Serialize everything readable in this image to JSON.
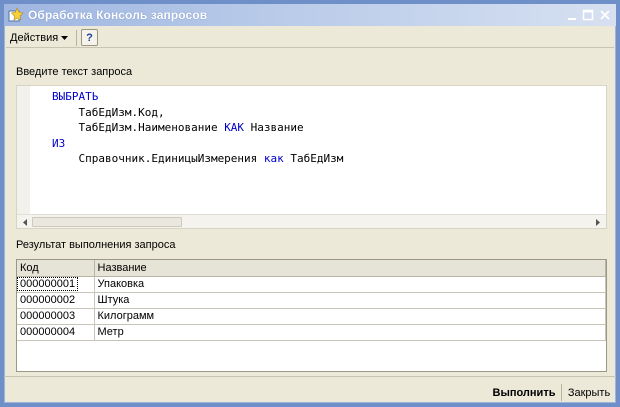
{
  "window": {
    "title": "Обработка  Консоль запросов"
  },
  "toolbar": {
    "actions_label": "Действия",
    "help_label": "?"
  },
  "query": {
    "label": "Введите текст запроса",
    "lines": [
      [
        {
          "t": "ВЫБРАТЬ",
          "kw": true
        }
      ],
      [
        {
          "t": "    ТабЕдИзм.Код,",
          "kw": false
        }
      ],
      [
        {
          "t": "    ТабЕдИзм.Наименование ",
          "kw": false
        },
        {
          "t": "КАК",
          "kw": true
        },
        {
          "t": " Название",
          "kw": false
        }
      ],
      [
        {
          "t": "ИЗ",
          "kw": true
        }
      ],
      [
        {
          "t": "    Справочник.ЕдиницыИзмерения ",
          "kw": false
        },
        {
          "t": "как",
          "kw": true
        },
        {
          "t": " ТабЕдИзм",
          "kw": false
        }
      ]
    ]
  },
  "result": {
    "label": "Результат выполнения запроса",
    "columns": [
      "Код",
      "Название"
    ],
    "rows": [
      [
        "000000001",
        "Упаковка"
      ],
      [
        "000000002",
        "Штука"
      ],
      [
        "000000003",
        "Килограмм"
      ],
      [
        "000000004",
        "Метр"
      ]
    ],
    "selected_row": 0
  },
  "footer": {
    "run_label": "Выполнить",
    "close_label": "Закрыть"
  },
  "colors": {
    "keyword": "#0000cc",
    "window_border": "#6f8fc8",
    "panel_bg": "#ece9d8"
  },
  "icons": [
    "app-icon",
    "minimize-icon",
    "maximize-icon",
    "close-icon",
    "dropdown-arrow-icon",
    "scroll-left-icon",
    "scroll-right-icon"
  ]
}
